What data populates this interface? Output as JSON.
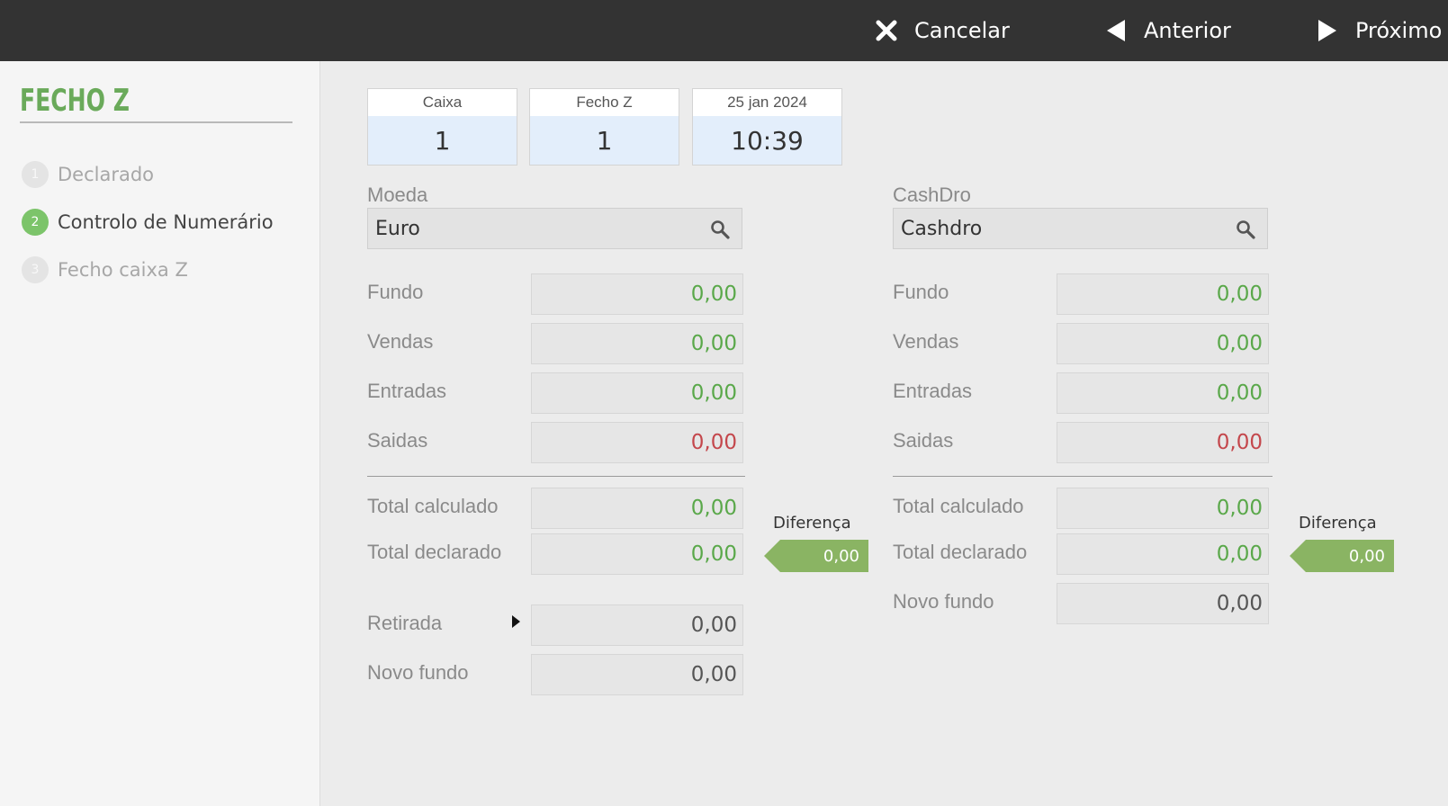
{
  "topbar": {
    "cancel_label": "Cancelar",
    "prev_label": "Anterior",
    "next_label": "Próximo"
  },
  "sidebar": {
    "title": "FECHO Z",
    "steps": [
      {
        "num": "1",
        "label": "Declarado",
        "state": "inactive"
      },
      {
        "num": "2",
        "label": "Controlo de Numerário",
        "state": "active"
      },
      {
        "num": "3",
        "label": "Fecho caixa Z",
        "state": "inactive"
      }
    ]
  },
  "info": {
    "caixa_label": "Caixa",
    "caixa_value": "1",
    "fecho_label": "Fecho Z",
    "fecho_value": "1",
    "date_label": "25 jan 2024",
    "time_value": "10:39"
  },
  "left": {
    "moeda_label": "Moeda",
    "moeda_value": "Euro",
    "rows": {
      "fundo_label": "Fundo",
      "fundo_value": "0,00",
      "vendas_label": "Vendas",
      "vendas_value": "0,00",
      "entradas_label": "Entradas",
      "entradas_value": "0,00",
      "saidas_label": "Saidas",
      "saidas_value": "0,00",
      "total_calc_label": "Total calculado",
      "total_calc_value": "0,00",
      "total_decl_label": "Total declarado",
      "total_decl_value": "0,00",
      "retirada_label": "Retirada",
      "retirada_value": "0,00",
      "novo_fundo_label": "Novo fundo",
      "novo_fundo_value": "0,00"
    },
    "diff_label": "Diferença",
    "diff_value": "0,00"
  },
  "right": {
    "cashdro_label": "CashDro",
    "cashdro_value": "Cashdro",
    "rows": {
      "fundo_label": "Fundo",
      "fundo_value": "0,00",
      "vendas_label": "Vendas",
      "vendas_value": "0,00",
      "entradas_label": "Entradas",
      "entradas_value": "0,00",
      "saidas_label": "Saidas",
      "saidas_value": "0,00",
      "total_calc_label": "Total calculado",
      "total_calc_value": "0,00",
      "total_decl_label": "Total declarado",
      "total_decl_value": "0,00",
      "novo_fundo_label": "Novo fundo",
      "novo_fundo_value": "0,00"
    },
    "diff_label": "Diferença",
    "diff_value": "0,00"
  },
  "colors": {
    "topbar": "#333333",
    "accent_green": "#6aaa5a",
    "value_green": "#5aa84a",
    "value_red": "#c4474c",
    "diff_tag": "#8ab463"
  },
  "icons": [
    "close-icon",
    "triangle-left-icon",
    "triangle-right-icon",
    "search-icon",
    "caret-right-icon"
  ]
}
